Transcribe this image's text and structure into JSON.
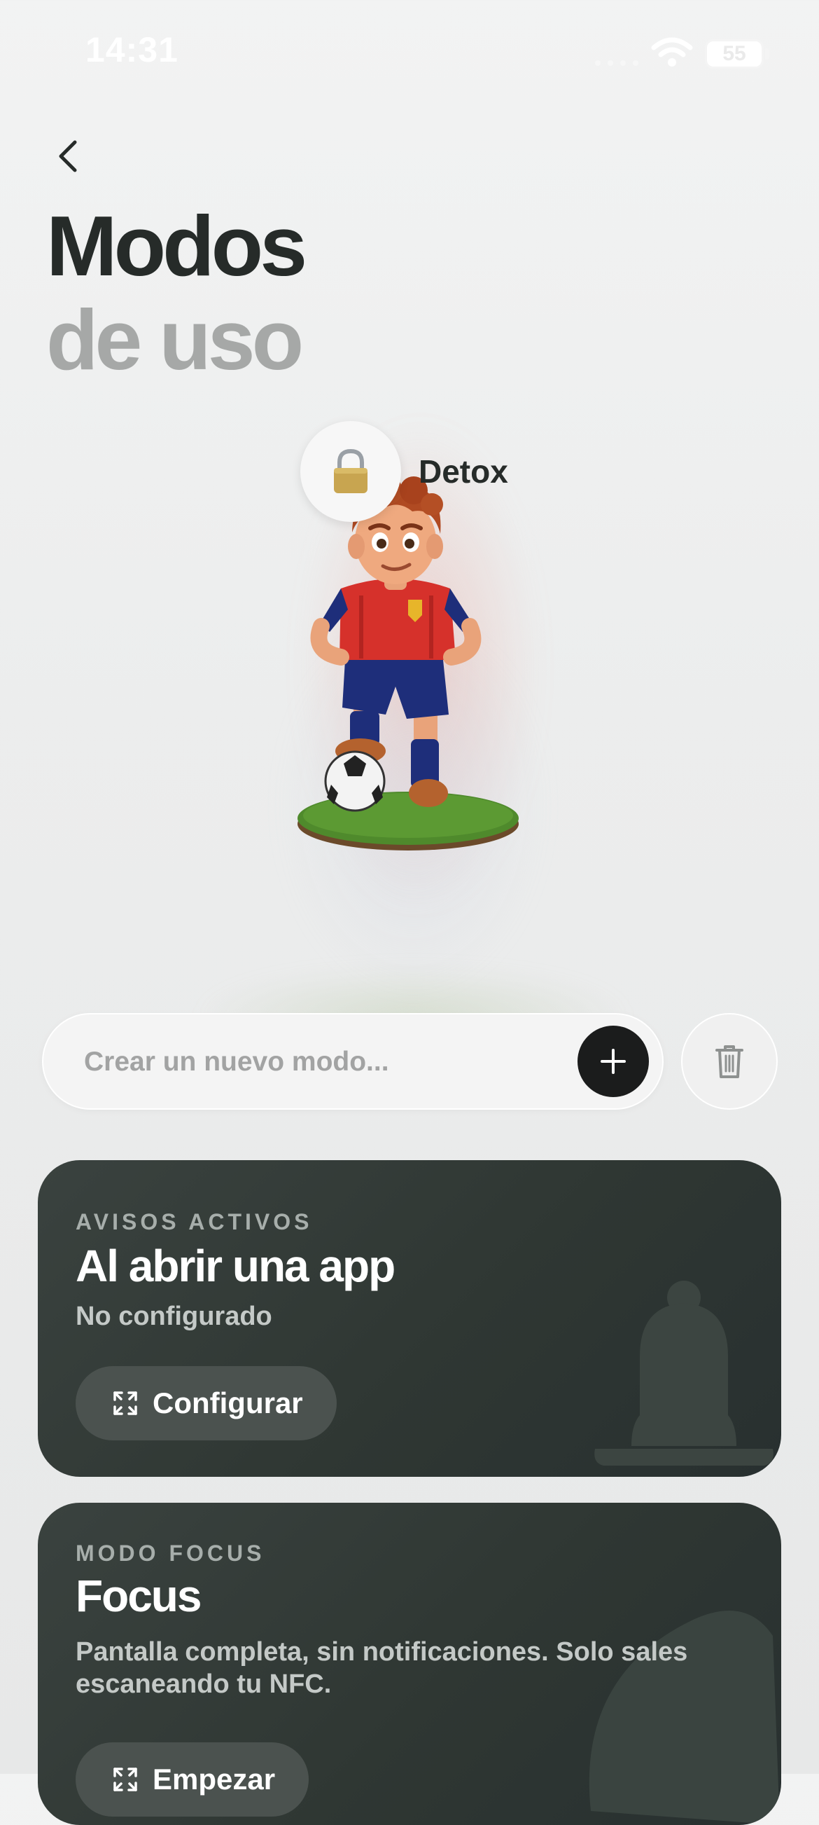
{
  "status_bar": {
    "time": "14:31",
    "battery": "55"
  },
  "header": {
    "title_line1": "Modos",
    "title_line2": "de uso"
  },
  "hero": {
    "mode_name": "Detox",
    "mode_icon": "lock-icon"
  },
  "create_mode": {
    "placeholder": "Crear un nuevo modo..."
  },
  "cards": [
    {
      "label": "AVISOS ACTIVOS",
      "title": "Al abrir una app",
      "subtitle": "No configurado",
      "button_label": "Configurar",
      "button_icon": "expand-icon",
      "background_icon": "bell-icon"
    },
    {
      "label": "MODO FOCUS",
      "title": "Focus",
      "subtitle": "Pantalla completa, sin notificaciones. Solo sales escaneando tu NFC.",
      "button_label": "Empezar",
      "button_icon": "expand-icon",
      "background_icon": "leaf-icon"
    }
  ],
  "colors": {
    "background": "#eceded",
    "card": "#2f3733",
    "title_primary": "#262b29",
    "title_secondary": "#a6a8a7",
    "add_button": "#1b1c1c"
  }
}
